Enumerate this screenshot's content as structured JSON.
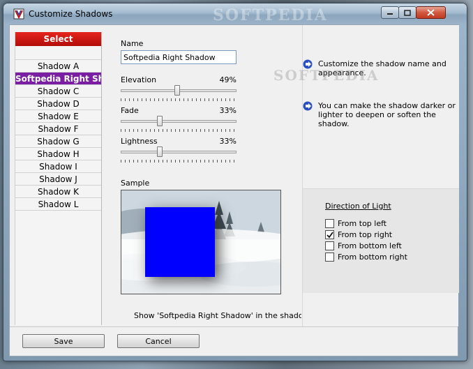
{
  "window": {
    "title": "Customize Shadows",
    "watermark": "SOFTPEDIA"
  },
  "shadow_list": {
    "header": "Select",
    "items": [
      {
        "label": "Shadow A",
        "selected": false
      },
      {
        "label": "Softpedia Right Shadow",
        "selected": true
      },
      {
        "label": "Shadow C",
        "selected": false
      },
      {
        "label": "Shadow D",
        "selected": false
      },
      {
        "label": "Shadow E",
        "selected": false
      },
      {
        "label": "Shadow F",
        "selected": false
      },
      {
        "label": "Shadow G",
        "selected": false
      },
      {
        "label": "Shadow H",
        "selected": false
      },
      {
        "label": "Shadow I",
        "selected": false
      },
      {
        "label": "Shadow J",
        "selected": false
      },
      {
        "label": "Shadow K",
        "selected": false
      },
      {
        "label": "Shadow L",
        "selected": false
      }
    ]
  },
  "editor": {
    "name_label": "Name",
    "name_value": "Softpedia Right Shadow",
    "elevation": {
      "label": "Elevation",
      "value": 49,
      "display": "49%"
    },
    "fade": {
      "label": "Fade",
      "value": 33,
      "display": "33%"
    },
    "lightness": {
      "label": "Lightness",
      "value": 33,
      "display": "33%"
    },
    "sample_label": "Sample",
    "show_in_selector": {
      "checked": true,
      "label": "Show 'Softpedia Right Shadow' in the shadows sel"
    }
  },
  "info": {
    "tip1": "Customize the shadow name and appearance.",
    "tip2": "You can make the shadow darker or lighter to deepen or soften the shadow.",
    "watermark": "SOFTPEDIA"
  },
  "direction": {
    "title": "Direction of Light",
    "options": [
      {
        "label": "From top left",
        "checked": false
      },
      {
        "label": "From top right",
        "checked": true
      },
      {
        "label": "From bottom left",
        "checked": false
      },
      {
        "label": "From bottom right",
        "checked": false
      }
    ]
  },
  "buttons": {
    "save": "Save",
    "cancel": "Cancel"
  },
  "colors": {
    "select_header": "#c8140f",
    "selected_item": "#7a1fa3",
    "sample_square": "#0000ff",
    "info_arrow": "#2b4fc7"
  }
}
